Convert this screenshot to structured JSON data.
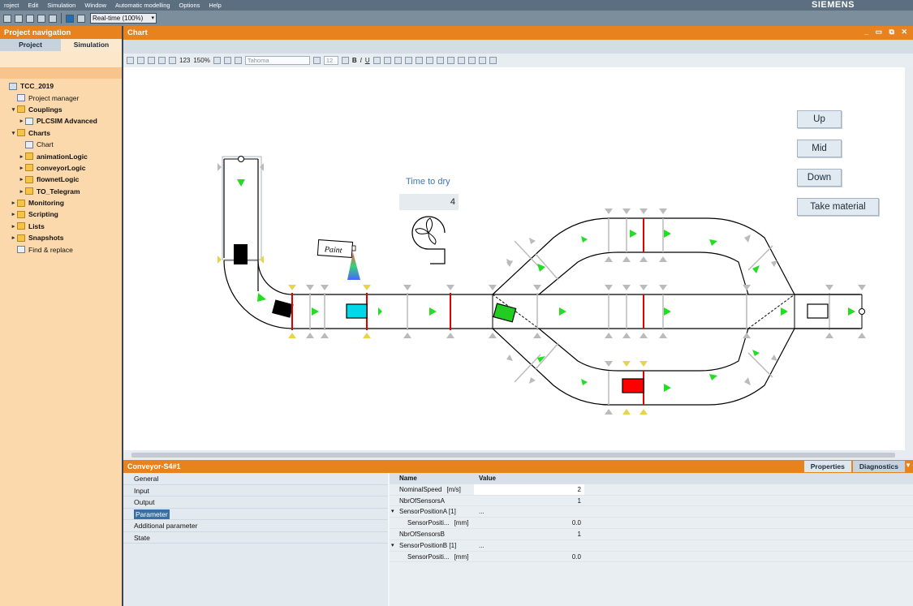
{
  "menubar": {
    "items": [
      "roject",
      "Edit",
      "Simulation",
      "Window",
      "Automatic modelling",
      "Options",
      "Help"
    ],
    "brand": "SIEMENS",
    "brand2": "SI"
  },
  "toolbar": {
    "realtime": "Real-time (100%)"
  },
  "left": {
    "title": "Project navigation",
    "tabs": [
      "Project",
      "Simulation"
    ],
    "tree": [
      {
        "label": "TCC_2019",
        "level": 0,
        "caret": "",
        "icon": "project",
        "bold": true
      },
      {
        "label": "Project manager",
        "level": 1,
        "caret": "",
        "icon": "doc",
        "bold": false
      },
      {
        "label": "Couplings",
        "level": 1,
        "caret": "▾",
        "icon": "folder",
        "bold": true
      },
      {
        "label": "PLCSIM Advanced",
        "level": 2,
        "caret": "▸",
        "icon": "doc",
        "bold": true
      },
      {
        "label": "Charts",
        "level": 1,
        "caret": "▾",
        "icon": "folder",
        "bold": true
      },
      {
        "label": "Chart",
        "level": 2,
        "caret": "",
        "icon": "doc",
        "bold": false
      },
      {
        "label": "animationLogic",
        "level": 2,
        "caret": "▸",
        "icon": "folder",
        "bold": true
      },
      {
        "label": "conveyorLogic",
        "level": 2,
        "caret": "▸",
        "icon": "folder",
        "bold": true
      },
      {
        "label": "flownetLogic",
        "level": 2,
        "caret": "▸",
        "icon": "folder",
        "bold": true
      },
      {
        "label": "TO_Telegram",
        "level": 2,
        "caret": "▸",
        "icon": "folder",
        "bold": true
      },
      {
        "label": "Monitoring",
        "level": 1,
        "caret": "▸",
        "icon": "folder",
        "bold": true
      },
      {
        "label": "Scripting",
        "level": 1,
        "caret": "▸",
        "icon": "folder",
        "bold": true
      },
      {
        "label": "Lists",
        "level": 1,
        "caret": "▸",
        "icon": "folder",
        "bold": true
      },
      {
        "label": "Snapshots",
        "level": 1,
        "caret": "▸",
        "icon": "folder",
        "bold": true
      },
      {
        "label": "Find & replace",
        "level": 1,
        "caret": "",
        "icon": "doc",
        "bold": false
      }
    ]
  },
  "chart": {
    "title": "Chart",
    "window_controls": "_ ▭ ⧉ ✕",
    "zoom": "150%",
    "font": "Tahoma",
    "font_size": "12",
    "tb_bold": "B",
    "tb_italic": "I",
    "tb_underline": "U",
    "tb_123": "123",
    "buttons": {
      "up": "Up",
      "mid": "Mid",
      "down": "Down",
      "take": "Take material"
    },
    "dry_label": "Time to dry",
    "dry_value": "4",
    "paint_label": "Paint"
  },
  "props": {
    "title": "Conveyor-S4#1",
    "tabs": [
      "Properties",
      "Diagnostics"
    ],
    "items": [
      "General",
      "Input",
      "Output",
      "Parameter",
      "Additional parameter",
      "State"
    ],
    "selected": "Parameter",
    "headers": {
      "name": "Name",
      "value": "Value"
    },
    "rows": [
      {
        "name": "NominalSpeed",
        "unit": "[m/s]",
        "value": "2",
        "toggle": "",
        "indent": false,
        "highlight": true
      },
      {
        "name": "NbrOfSensorsA",
        "unit": "",
        "value": "1",
        "toggle": "",
        "indent": false,
        "highlight": false
      },
      {
        "name": "SensorPositionA [1]",
        "unit": "",
        "value": "...",
        "toggle": "▾",
        "indent": false,
        "highlight": false
      },
      {
        "name": "SensorPositi...",
        "unit": "[mm]",
        "value": "0.0",
        "toggle": "",
        "indent": true,
        "highlight": false
      },
      {
        "name": "NbrOfSensorsB",
        "unit": "",
        "value": "1",
        "toggle": "",
        "indent": false,
        "highlight": false
      },
      {
        "name": "SensorPositionB [1]",
        "unit": "",
        "value": "...",
        "toggle": "▾",
        "indent": false,
        "highlight": false
      },
      {
        "name": "SensorPositi...",
        "unit": "[mm]",
        "value": "0.0",
        "toggle": "",
        "indent": true,
        "highlight": false
      }
    ]
  },
  "colors": {
    "accent": "#e8821f",
    "sensor_red": "#e00000",
    "arrow_green": "#22dd22",
    "item_cyan": "#00d8e8",
    "item_green": "#22cc22",
    "item_red": "#ff0000"
  }
}
